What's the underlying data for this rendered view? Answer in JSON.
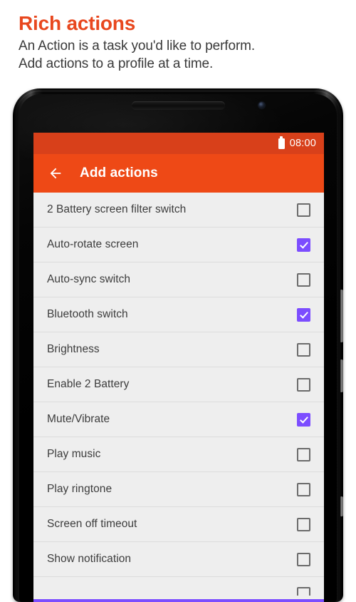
{
  "intro": {
    "title": "Rich actions",
    "subtitle_line1": "An Action is a task you'd like to perform.",
    "subtitle_line2": "Add actions to a profile at a time.",
    "title_color": "#E8471E"
  },
  "phone": {
    "speaker_name": "earpiece-speaker",
    "camera_name": "front-camera"
  },
  "screen": {
    "statusbar": {
      "battery_icon": "battery-full-icon",
      "time": "08:00",
      "background_color": "#D8401A"
    },
    "toolbar": {
      "back_icon": "back-arrow-icon",
      "title": "Add actions",
      "background_color": "#EE4916"
    },
    "list": {
      "checked_color": "#7C4DFF",
      "unchecked_border_color": "#6B6B6B",
      "rows": [
        {
          "label": "2 Battery screen filter switch",
          "checked": false
        },
        {
          "label": "Auto-rotate screen",
          "checked": true
        },
        {
          "label": "Auto-sync switch",
          "checked": false
        },
        {
          "label": "Bluetooth switch",
          "checked": true
        },
        {
          "label": "Brightness",
          "checked": false
        },
        {
          "label": "Enable 2 Battery",
          "checked": false
        },
        {
          "label": "Mute/Vibrate",
          "checked": true
        },
        {
          "label": "Play music",
          "checked": false
        },
        {
          "label": "Play ringtone",
          "checked": false
        },
        {
          "label": "Screen off timeout",
          "checked": false
        },
        {
          "label": "Show notification",
          "checked": false
        },
        {
          "label": "",
          "checked": false
        }
      ]
    },
    "bottom_accent_color": "#7C4DFF"
  }
}
